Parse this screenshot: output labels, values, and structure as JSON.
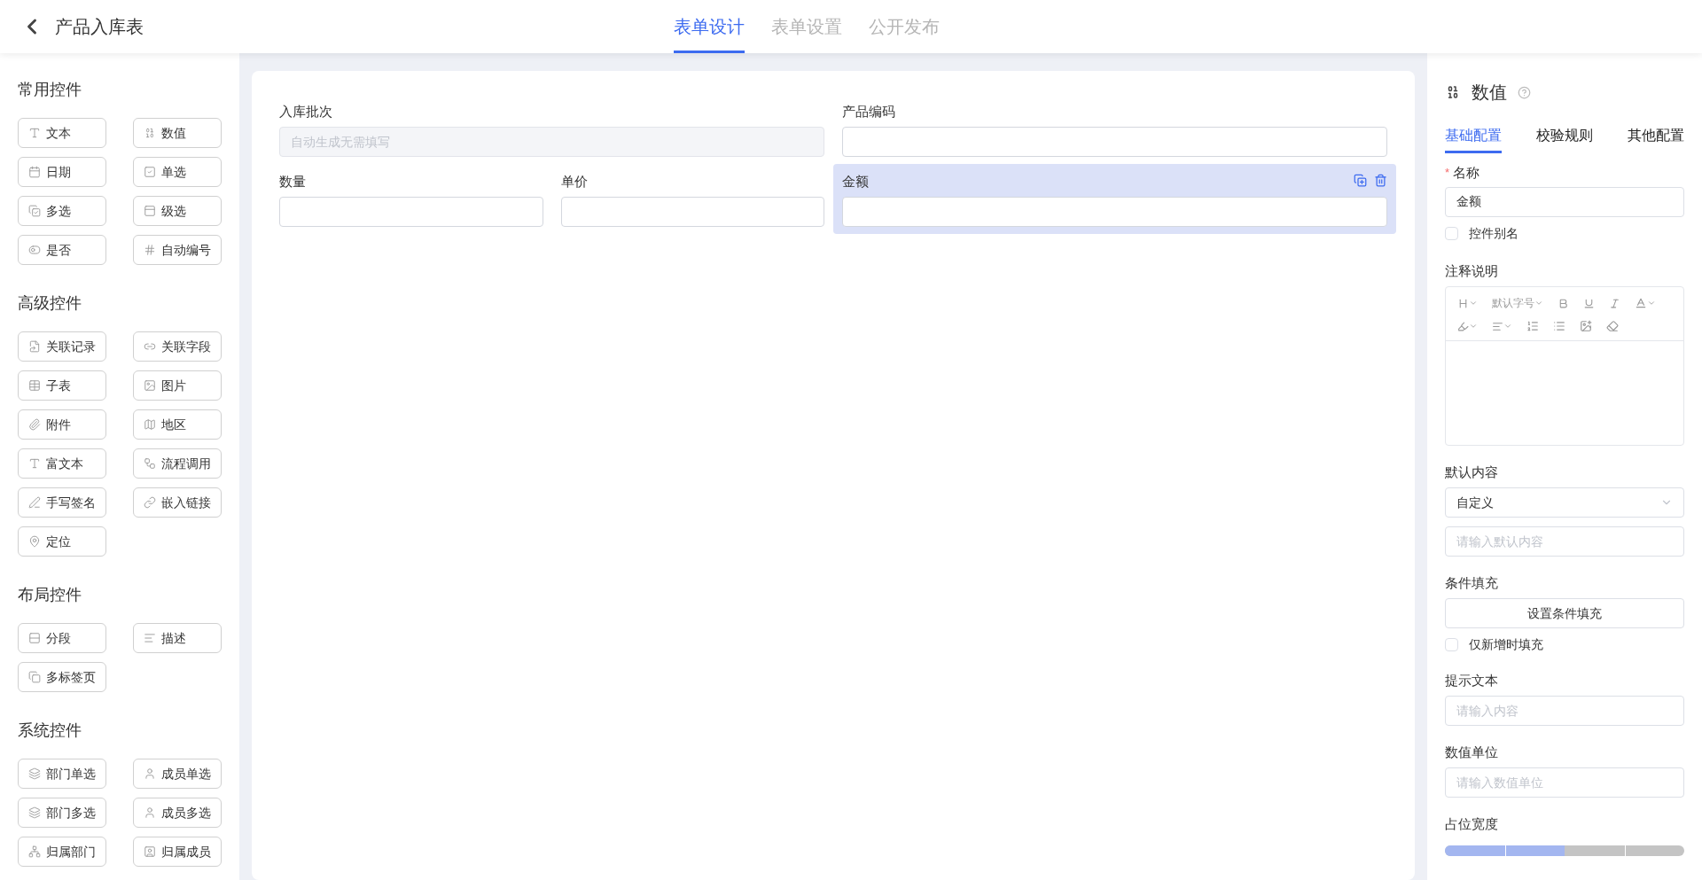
{
  "header": {
    "title": "产品入库表",
    "tabs": [
      {
        "label": "表单设计",
        "selected": true
      },
      {
        "label": "表单设置",
        "selected": false
      },
      {
        "label": "公开发布",
        "selected": false
      }
    ]
  },
  "sidebar": {
    "sections": [
      {
        "title": "常用控件",
        "items": [
          "文本",
          "数值",
          "日期",
          "单选",
          "多选",
          "级选",
          "是否",
          "自动编号"
        ]
      },
      {
        "title": "高级控件",
        "items": [
          "关联记录",
          "关联字段",
          "子表",
          "图片",
          "附件",
          "地区",
          "富文本",
          "流程调用",
          "手写签名",
          "嵌入链接",
          "定位"
        ]
      },
      {
        "title": "布局控件",
        "items": [
          "分段",
          "描述",
          "多标签页"
        ]
      },
      {
        "title": "系统控件",
        "items": [
          "部门单选",
          "成员单选",
          "部门多选",
          "成员多选",
          "归属部门",
          "归属成员"
        ]
      }
    ]
  },
  "form": {
    "fields": [
      {
        "label": "入库批次",
        "placeholder": "自动生成无需填写",
        "disabled": true,
        "selected": false
      },
      {
        "label": "产品编码",
        "disabled": false,
        "selected": false
      },
      {
        "label": "数量",
        "disabled": false,
        "selected": false
      },
      {
        "label": "单价",
        "disabled": false,
        "selected": false
      },
      {
        "label": "金额",
        "disabled": false,
        "selected": true
      }
    ]
  },
  "properties": {
    "title": "数值",
    "tabs": [
      {
        "label": "基础配置",
        "selected": true
      },
      {
        "label": "校验规则",
        "selected": false
      },
      {
        "label": "其他配置",
        "selected": false
      }
    ],
    "name": {
      "label": "名称",
      "required_mark": "*",
      "value": "金额"
    },
    "alias": {
      "label": "控件别名",
      "checked": false
    },
    "note": {
      "label": "注释说明",
      "font_size": "默认字号"
    },
    "default": {
      "label": "默认内容",
      "value": "自定义",
      "placeholder": "请输入默认内容"
    },
    "condition": {
      "label": "条件填充",
      "button": "设置条件填充",
      "only_new": {
        "label": "仅新增时填充",
        "checked": false
      }
    },
    "hint": {
      "label": "提示文本",
      "placeholder": "请输入内容"
    },
    "unit": {
      "label": "数值单位",
      "placeholder": "请输入数值单位"
    },
    "width": {
      "label": "占位宽度",
      "level": 0.5
    }
  }
}
